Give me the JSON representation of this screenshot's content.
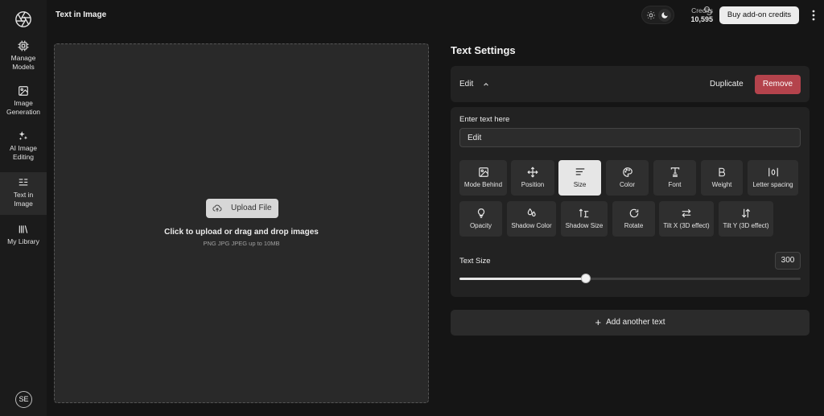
{
  "sidebar": {
    "items": [
      {
        "label": "Manage\nModels",
        "icon": "chip-icon"
      },
      {
        "label": "Image\nGeneration",
        "icon": "image-icon"
      },
      {
        "label": "AI Image\nEditing",
        "icon": "sparkles-icon"
      },
      {
        "label": "Text in\nImage",
        "icon": "text-align-icon"
      },
      {
        "label": "My Library",
        "icon": "library-icon"
      }
    ],
    "active_index": 3,
    "avatar": "SE"
  },
  "header": {
    "title": "Text in Image",
    "credits_label": "Credits",
    "credits_value": "10,595",
    "buy_label": "Buy add-on credits"
  },
  "upload": {
    "button_label": "Upload File",
    "title": "Click to upload or drag and drop images",
    "subtitle": "PNG JPG JPEG up to 10MB"
  },
  "settings": {
    "title": "Text Settings",
    "edit_label": "Edit",
    "duplicate_label": "Duplicate",
    "remove_label": "Remove",
    "field_label": "Enter text here",
    "field_value": "Edit",
    "tools_row1": [
      {
        "label": "Mode Behind",
        "icon": "image-layer-icon"
      },
      {
        "label": "Position",
        "icon": "move-icon"
      },
      {
        "label": "Size",
        "icon": "lines-icon"
      },
      {
        "label": "Color",
        "icon": "palette-icon"
      },
      {
        "label": "Font",
        "icon": "font-icon"
      },
      {
        "label": "Weight",
        "icon": "bold-icon"
      },
      {
        "label": "Letter spacing",
        "icon": "letter-spacing-icon"
      }
    ],
    "tools_row2": [
      {
        "label": "Opacity",
        "icon": "bulb-icon"
      },
      {
        "label": "Shadow Color",
        "icon": "drops-icon"
      },
      {
        "label": "Shadow Size",
        "icon": "text-size-icon"
      },
      {
        "label": "Rotate",
        "icon": "rotate-icon"
      },
      {
        "label": "Tilt X (3D effect)",
        "icon": "arrows-horizontal-icon"
      },
      {
        "label": "Tilt Y (3D effect)",
        "icon": "arrows-vertical-icon"
      }
    ],
    "active_tool": "Size",
    "size_label": "Text Size",
    "size_value": "300",
    "size_fraction": 0.37,
    "add_label": "Add another text"
  },
  "colors": {
    "accent_remove": "#b4434c",
    "active_tool_bg": "#e6e6e6"
  }
}
